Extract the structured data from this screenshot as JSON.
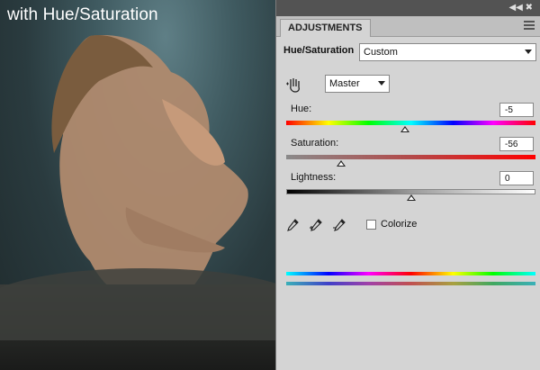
{
  "photo": {
    "caption": "with Hue/Saturation"
  },
  "panel": {
    "tab_label": "ADJUSTMENTS",
    "title_label": "Hue/Saturation",
    "preset_value": "Custom",
    "channel_value": "Master",
    "hue": {
      "label": "Hue:",
      "value": "-5",
      "position": 0.475
    },
    "saturation": {
      "label": "Saturation:",
      "value": "-56",
      "position": 0.22
    },
    "lightness": {
      "label": "Lightness:",
      "value": "0",
      "position": 0.5
    },
    "colorize_label": "Colorize",
    "colorize_checked": false
  },
  "icons": {
    "collapse": "double-chevron-right-icon",
    "menu": "panel-menu-icon",
    "hand": "targeted-adjustment-hand-icon",
    "eyedroppers": [
      "eyedropper-icon",
      "eyedropper-plus-icon",
      "eyedropper-minus-icon"
    ]
  }
}
